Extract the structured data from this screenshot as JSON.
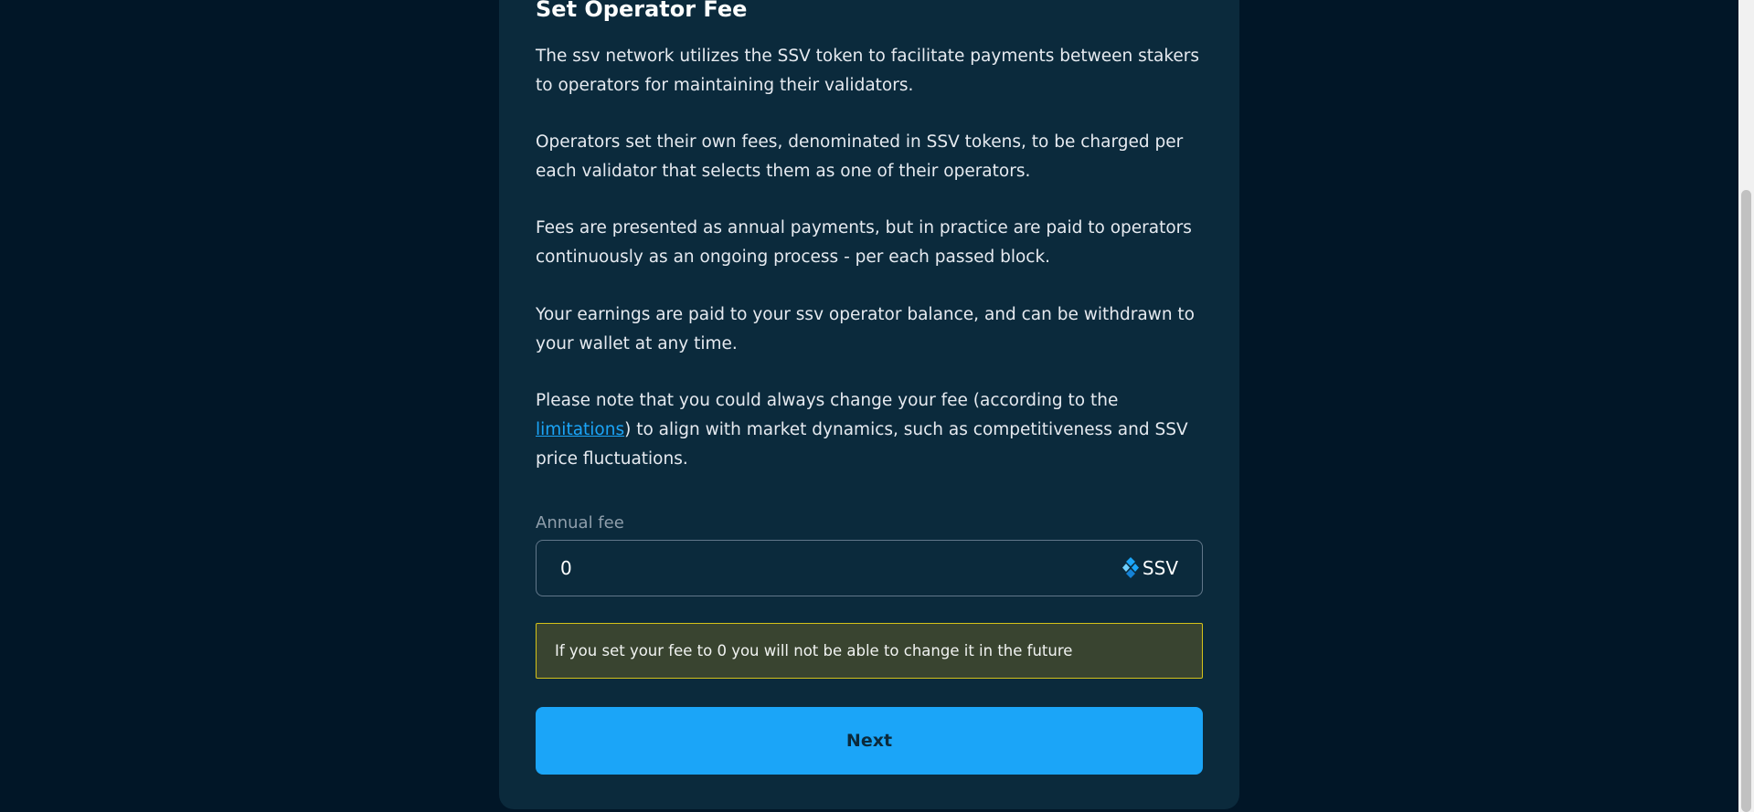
{
  "form": {
    "title": "Set Operator Fee",
    "paragraphs": [
      "The ssv network utilizes the SSV token to facilitate payments between stakers to operators for maintaining their validators.",
      "Operators set their own fees, denominated in SSV tokens, to be charged per each validator that selects them as one of their operators.",
      "Fees are presented as annual payments, but in practice are paid to operators continuously as an ongoing process - per each passed block.",
      "Your earnings are paid to your ssv operator balance, and can be withdrawn to your wallet at any time."
    ],
    "note": {
      "prefix": "Please note that you could always change your fee (according to the ",
      "link": "limitations",
      "suffix": ") to align with market dynamics, such as competitiveness and SSV price fluctuations."
    },
    "fee_label": "Annual fee",
    "fee_value": "0",
    "fee_unit": "SSV",
    "fee_unit_icon": "ssv-token-icon",
    "warning": "If you set your fee to 0 you will not be able to change it in the future",
    "next_label": "Next"
  },
  "colors": {
    "page_background": "#011627",
    "card_background": "#0b2a3c",
    "accent": "#1ba5f8",
    "warning_border": "#d4c21a",
    "warning_background": "#394430"
  }
}
